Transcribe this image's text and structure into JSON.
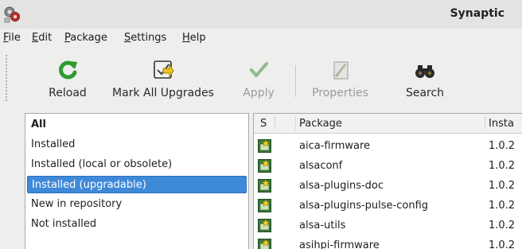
{
  "window": {
    "title": "Synaptic",
    "app_icon": "synaptic-icon"
  },
  "menu": [
    {
      "label": "File"
    },
    {
      "label": "Edit"
    },
    {
      "label": "Package"
    },
    {
      "label": "Settings"
    },
    {
      "label": "Help"
    }
  ],
  "toolbar": {
    "reload": {
      "label": "Reload",
      "icon": "reload-icon",
      "enabled": true
    },
    "mark_all_upgrades": {
      "label": "Mark All Upgrades",
      "icon": "mark-upgrades-icon",
      "enabled": true
    },
    "apply": {
      "label": "Apply",
      "icon": "apply-checkmark-icon",
      "enabled": false
    },
    "properties": {
      "label": "Properties",
      "icon": "properties-icon",
      "enabled": false
    },
    "search": {
      "label": "Search",
      "icon": "binoculars-icon",
      "enabled": true
    }
  },
  "filters": [
    {
      "label": "All",
      "bold": true,
      "selected": false
    },
    {
      "label": "Installed",
      "bold": false,
      "selected": false
    },
    {
      "label": "Installed (local or obsolete)",
      "bold": false,
      "selected": false
    },
    {
      "label": "Installed (upgradable)",
      "bold": false,
      "selected": true
    },
    {
      "label": "New in repository",
      "bold": false,
      "selected": false
    },
    {
      "label": "Not installed",
      "bold": false,
      "selected": false
    }
  ],
  "package_table": {
    "columns": {
      "status": "S",
      "package": "Package",
      "installed": "Insta"
    },
    "rows": [
      {
        "status_icon": "upgradable-package-icon",
        "name": "aica-firmware",
        "installed": "1.0.2"
      },
      {
        "status_icon": "upgradable-package-icon",
        "name": "alsaconf",
        "installed": "1.0.2"
      },
      {
        "status_icon": "upgradable-package-icon",
        "name": "alsa-plugins-doc",
        "installed": "1.0.2"
      },
      {
        "status_icon": "upgradable-package-icon",
        "name": "alsa-plugins-pulse-config",
        "installed": "1.0.2"
      },
      {
        "status_icon": "upgradable-package-icon",
        "name": "alsa-utils",
        "installed": "1.0.2"
      },
      {
        "status_icon": "upgradable-package-icon",
        "name": "asihpi-firmware",
        "installed": "1.0.2"
      }
    ]
  },
  "colors": {
    "selection": "#3f89d9",
    "reload_green": "#2f9a2f",
    "status_icon_green": "#3a7a3a",
    "status_star": "#f5d020"
  }
}
